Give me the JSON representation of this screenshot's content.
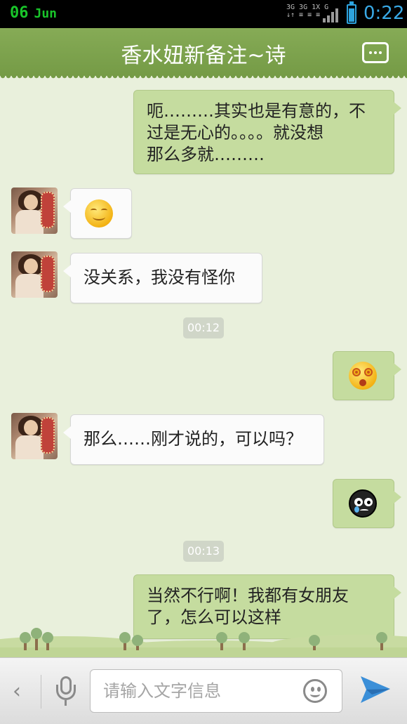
{
  "status_bar": {
    "date_day": "06",
    "date_month": "Jun",
    "network_top": "3G 3G 1X G",
    "network_bottom": "↓↑ ≡ ≡ ≡",
    "time": "0:22",
    "battery_level": 0.85,
    "accent_color": "#2ea3de"
  },
  "header": {
    "title": "香水妞新备注~诗",
    "menu_icon": "more-menu-icon"
  },
  "messages": [
    {
      "side": "right",
      "type": "text",
      "text_lines": [
        "呃………其实也是有意的，不",
        "过是无心的。。。。就没想",
        "那么多就………"
      ]
    },
    {
      "side": "left",
      "type": "emoji",
      "emoji": "smile-emoji"
    },
    {
      "side": "left",
      "type": "text",
      "text": "没关系，我没有怪你"
    },
    {
      "type": "timestamp",
      "text": "00:12"
    },
    {
      "side": "right",
      "type": "emoji",
      "emoji": "dizzy-emoji"
    },
    {
      "side": "left",
      "type": "text",
      "text": "那么……刚才说的，可以吗？"
    },
    {
      "side": "right",
      "type": "emoji",
      "emoji": "crying-emoji"
    },
    {
      "type": "timestamp",
      "text": "00:13"
    },
    {
      "side": "right",
      "type": "text",
      "text_lines": [
        "当然不行啊！我都有女朋友",
        "了，怎么可以这样"
      ]
    }
  ],
  "input_bar": {
    "back_icon": "chevron-left-icon",
    "voice_icon": "microphone-icon",
    "placeholder": "请输入文字信息",
    "emoji_icon": "smiley-icon",
    "send_icon": "send-icon"
  },
  "colors": {
    "header_bg": "#7fa44f",
    "chat_bg": "#e9f0dc",
    "own_bubble": "#c5dc9f",
    "other_bubble": "#fbfbfb"
  }
}
